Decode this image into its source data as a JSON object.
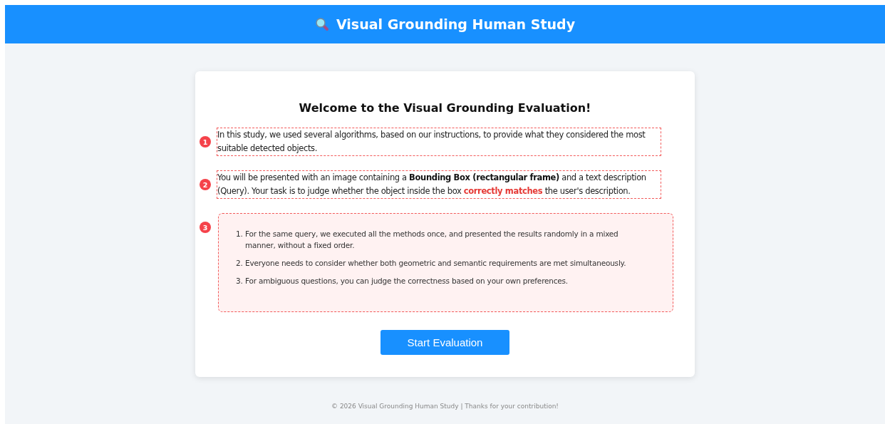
{
  "header": {
    "title": "Visual Grounding Human Study"
  },
  "card": {
    "heading": "Welcome to the Visual Grounding Evaluation!",
    "sections": [
      {
        "kind": "text",
        "marker": "1",
        "text": "In this study, we used several algorithms, based on our instructions, to provide what they considered the most suitable detected objects."
      },
      {
        "kind": "text",
        "marker": "2",
        "segments": [
          {
            "kind": "plain",
            "text": "You will be presented with an image containing a"
          },
          {
            "kind": "bold",
            "text": "Bounding Box (rectangular frame)"
          },
          {
            "kind": "plain",
            "text": "and a text description (Query). Your task is to judge whether the object inside the box"
          },
          {
            "kind": "highlight",
            "text": "correctly matches"
          },
          {
            "kind": "plain",
            "text": "the user's description."
          }
        ]
      },
      {
        "kind": "list",
        "marker": "3",
        "items": [
          {
            "number": "1.",
            "text": "For the same query, we executed all the methods once, and presented the results randomly in a mixed manner, without a fixed order."
          },
          {
            "number": "2.",
            "text": "Everyone needs to consider whether both geometric and semantic requirements are met simultaneously."
          },
          {
            "number": "3.",
            "text": "For ambiguous questions, you can judge the correctness based on your own preferences."
          }
        ]
      }
    ],
    "button": "Start Evaluation"
  },
  "footer": "© 2026 Visual Grounding Human Study | Thanks for your contribution!"
}
